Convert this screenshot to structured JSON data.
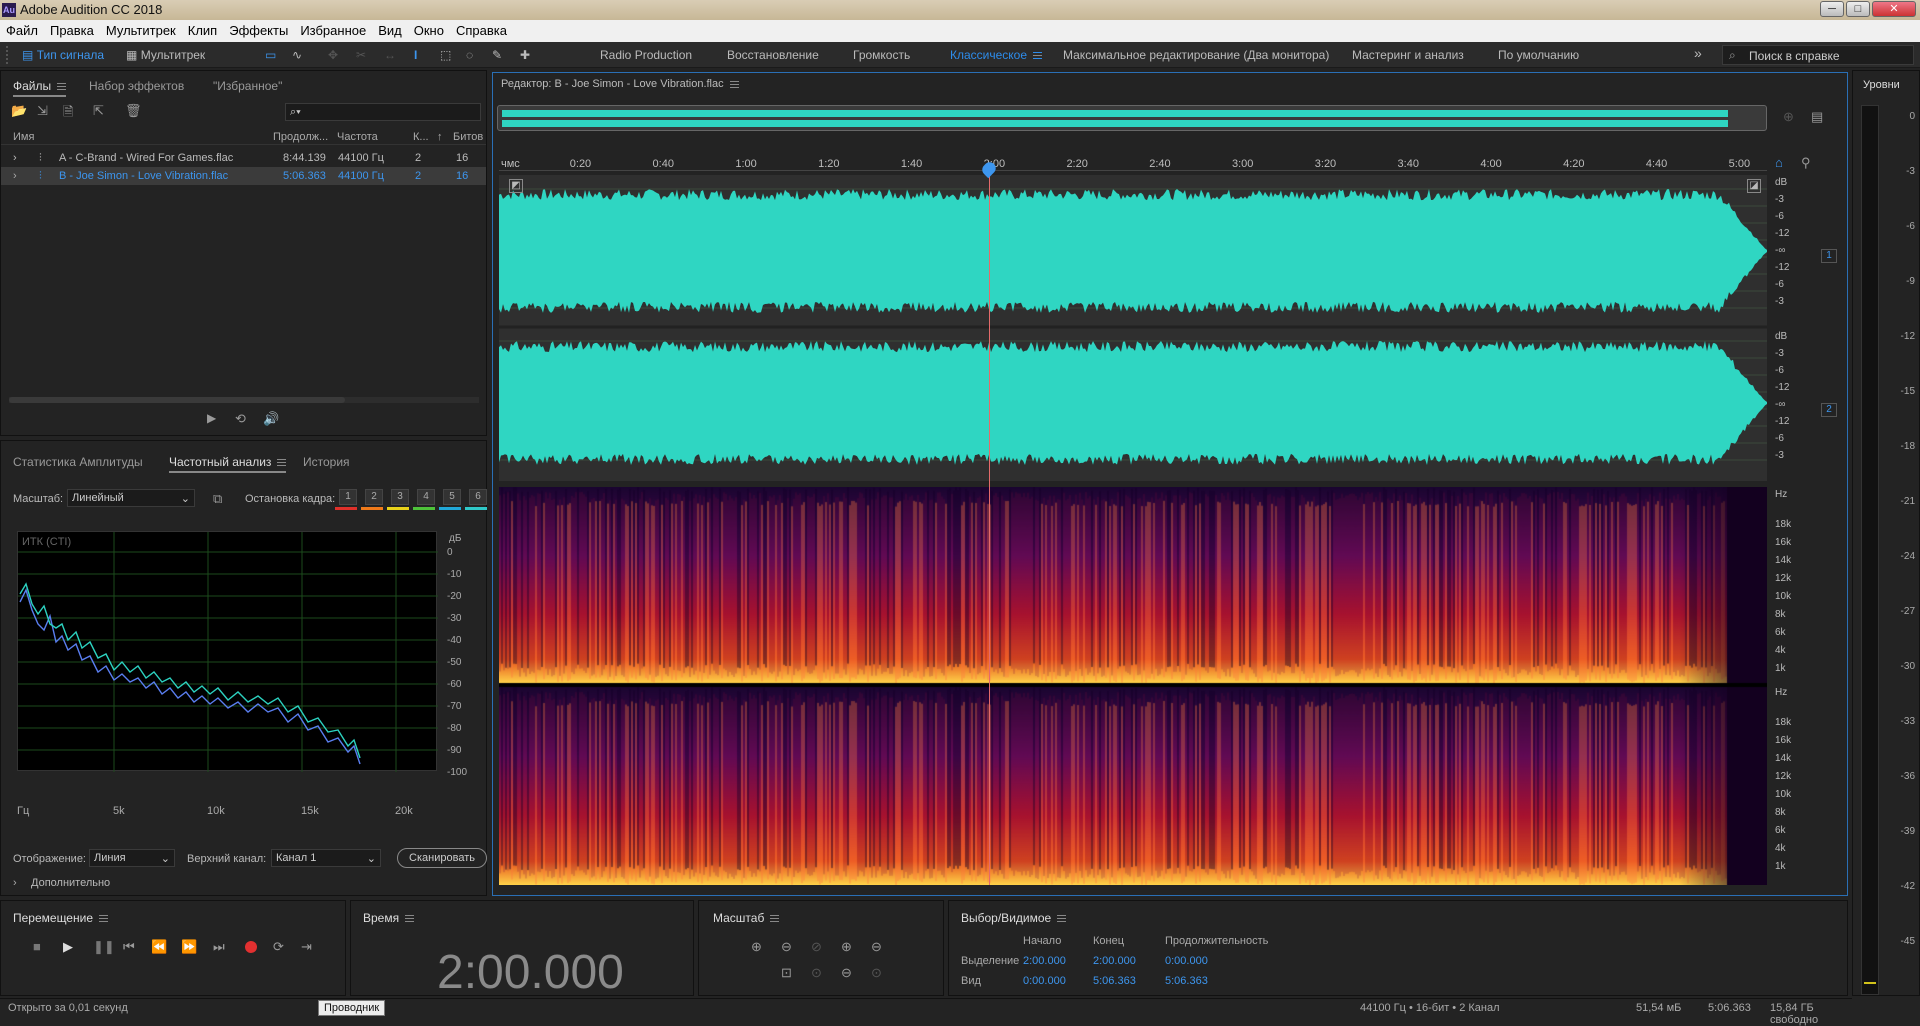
{
  "window": {
    "title": "Adobe Audition CC 2018",
    "logo": "Au",
    "minimize": "─",
    "restore": "□",
    "close": "✕"
  },
  "menu": [
    "Файл",
    "Правка",
    "Мультитрек",
    "Клип",
    "Эффекты",
    "Избранное",
    "Вид",
    "Окно",
    "Справка"
  ],
  "toolbar": {
    "waveform_mode": "Тип сигнала",
    "multitrack_mode": "Мультитрек",
    "more": "»",
    "search_placeholder": "Поиск в справке"
  },
  "workspaces": [
    "Radio Production",
    "Восстановление",
    "Громкость",
    "Классическое",
    "Максимальное редактирование (Два монитора)",
    "Мастеринг и анализ",
    "По умолчанию"
  ],
  "active_workspace": "Классическое",
  "files_panel": {
    "tabs": [
      "Файлы",
      "Набор эффектов",
      "\"Избранное\""
    ],
    "search_icon": "⌕▾",
    "columns": [
      "Имя",
      "Продолж...",
      "Частота",
      "К...",
      "↑",
      "Битов"
    ],
    "rows": [
      {
        "name": "A - C-Brand - Wired For Games.flac",
        "duration": "8:44.139",
        "rate": "44100 Гц",
        "ch": "2",
        "bits": "16"
      },
      {
        "name": "B - Joe Simon - Love Vibration.flac",
        "duration": "5:06.363",
        "rate": "44100 Гц",
        "ch": "2",
        "bits": "16"
      }
    ]
  },
  "analysis_panel": {
    "tabs": [
      "Статистика Амплитуды",
      "Частотный анализ",
      "История"
    ],
    "scale_label": "Масштаб:",
    "scale_value": "Линейный",
    "freeze_label": "Остановка кадра:",
    "freeze_buttons": [
      "1",
      "2",
      "3",
      "4",
      "5",
      "6"
    ],
    "freeze_colors": [
      "#e0302a",
      "#f07a1a",
      "#e8d21a",
      "#4ec23a",
      "#21a8d8",
      "#2fc8c8"
    ],
    "graph_title": "ИТК (CTI)",
    "db_unit": "дБ",
    "db_ticks": [
      "0",
      "-10",
      "-20",
      "-30",
      "-40",
      "-50",
      "-60",
      "-70",
      "-80",
      "-90",
      "-100"
    ],
    "hz_ticks": [
      "Гц",
      "5k",
      "10k",
      "15k",
      "20k"
    ],
    "display_label": "Отображение:",
    "display_value": "Линия",
    "channel_label": "Верхний канал:",
    "channel_value": "Канал 1",
    "scan_button": "Сканировать",
    "advanced": "Дополнительно"
  },
  "editor": {
    "title": "Редактор: B - Joe Simon - Love Vibration.flac",
    "ruler_unit": "чмс",
    "ruler": [
      "0:20",
      "0:40",
      "1:00",
      "1:20",
      "1:40",
      "2:00",
      "2:20",
      "2:40",
      "3:00",
      "3:20",
      "3:40",
      "4:00",
      "4:20",
      "4:40",
      "5:00"
    ],
    "db_scale": [
      "dB",
      "-3",
      "-6",
      "-12",
      "-∞",
      "-12",
      "-6",
      "-3"
    ],
    "hz_scale": [
      "Hz",
      "18k",
      "16k",
      "14k",
      "12k",
      "10k",
      "8k",
      "6k",
      "4k",
      "1k"
    ],
    "channels": [
      "1",
      "2"
    ],
    "waveform_color": "#2fd6c2"
  },
  "levels": {
    "title": "Уровни",
    "ticks": [
      "0",
      "-3",
      "-6",
      "-9",
      "-12",
      "-15",
      "-18",
      "-21",
      "-24",
      "-27",
      "-30",
      "-33",
      "-36",
      "-39",
      "-42",
      "-45"
    ]
  },
  "transport": {
    "title": "Перемещение",
    "buttons": [
      "stop",
      "play",
      "pause",
      "go-start",
      "rewind",
      "fast-forward",
      "go-end",
      "record",
      "loop",
      "skip"
    ]
  },
  "time": {
    "title": "Время",
    "value": "2:00.000"
  },
  "zoom": {
    "title": "Масштаб"
  },
  "selection": {
    "title": "Выбор/Видимое",
    "cols": [
      "Начало",
      "Конец",
      "Продолжительность"
    ],
    "rows": [
      {
        "label": "Выделение",
        "start": "2:00.000",
        "end": "2:00.000",
        "dur": "0:00.000"
      },
      {
        "label": "Вид",
        "start": "0:00.000",
        "end": "5:06.363",
        "dur": "5:06.363"
      }
    ]
  },
  "status": {
    "left": "Открыто за 0,01 секунд",
    "tooltip": "Проводник",
    "format": "44100 Гц • 16-бит • 2 Канал",
    "size": "51,54 мБ",
    "duration": "5:06.363",
    "free": "15,84 ГБ свободно"
  }
}
